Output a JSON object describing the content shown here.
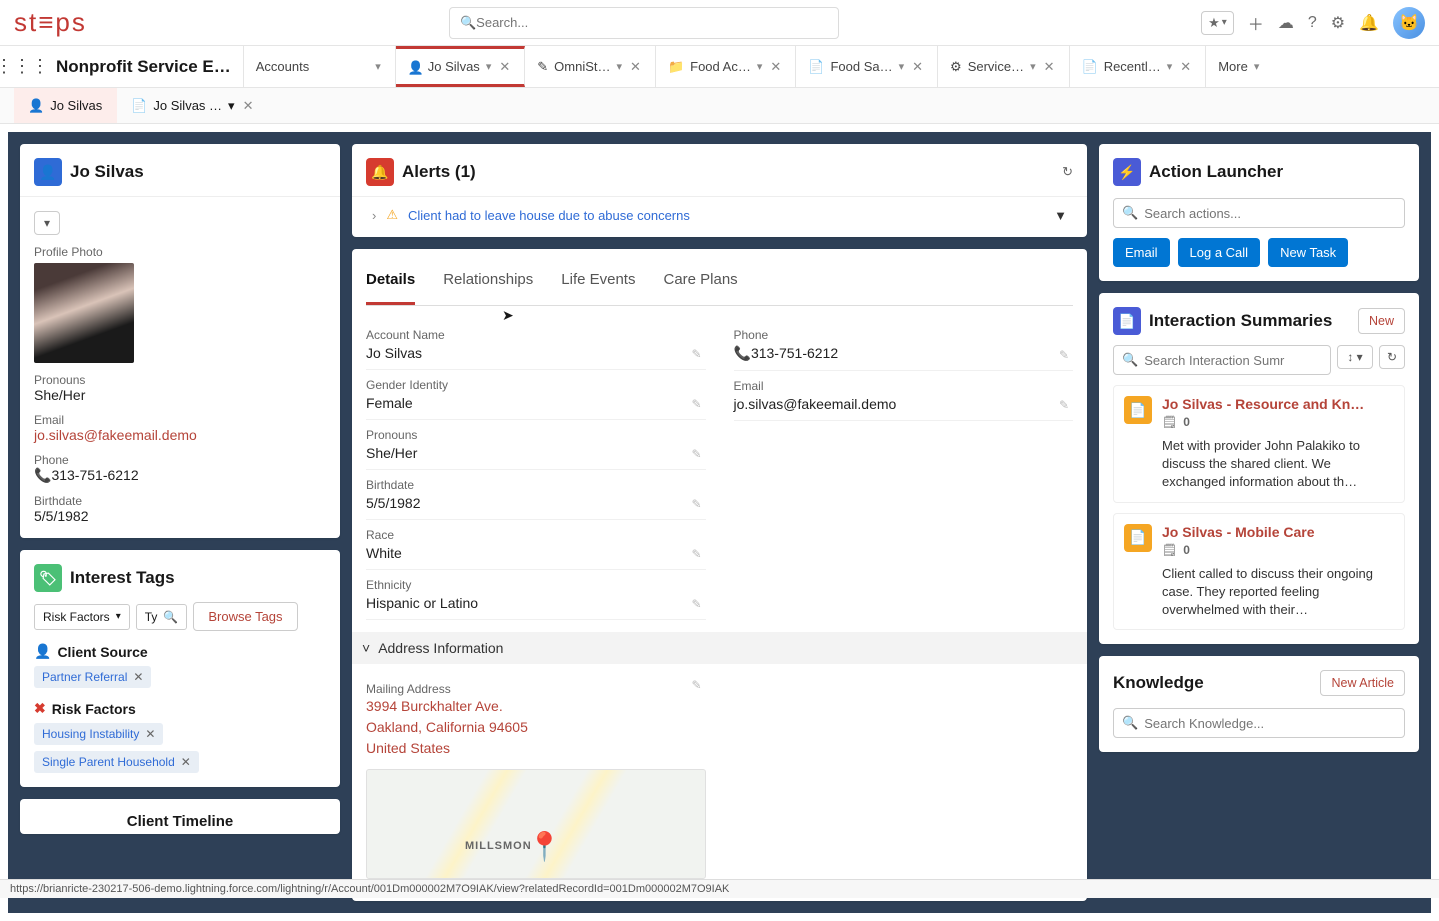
{
  "header": {
    "logo": "st≡ps",
    "search_placeholder": "Search..."
  },
  "nav": {
    "app_name": "Nonprofit Service E…",
    "tabs": [
      {
        "label": "Accounts",
        "has_close": false
      },
      {
        "label": "Jo Silvas",
        "active": true,
        "has_close": true
      },
      {
        "label": "OmniSt…",
        "has_close": true
      },
      {
        "label": "Food Ac…",
        "has_close": true
      },
      {
        "label": "Food Sa…",
        "has_close": true
      },
      {
        "label": "Service…",
        "has_close": true
      },
      {
        "label": "Recentl…",
        "has_close": true
      }
    ],
    "more_label": "More"
  },
  "subtabs": [
    {
      "label": "Jo Silvas",
      "active": true
    },
    {
      "label": "Jo Silvas …",
      "active": false,
      "has_close": true
    }
  ],
  "left": {
    "name": "Jo Silvas",
    "profile_photo_label": "Profile Photo",
    "pronouns_label": "Pronouns",
    "pronouns_value": "She/Her",
    "email_label": "Email",
    "email_value": "jo.silvas@fakeemail.demo",
    "phone_label": "Phone",
    "phone_value": "313-751-6212",
    "birthdate_label": "Birthdate",
    "birthdate_value": "5/5/1982",
    "interest_tags_header": "Interest Tags",
    "tag_filter_label": "Risk Factors",
    "tag_search_placeholder": "Ty",
    "browse_tags_label": "Browse Tags",
    "groups": [
      {
        "name": "Client Source",
        "tags": [
          "Partner Referral"
        ]
      },
      {
        "name": "Risk Factors",
        "risk": true,
        "tags": [
          "Housing Instability",
          "Single Parent Household"
        ]
      }
    ],
    "timeline_header": "Client Timeline"
  },
  "alerts": {
    "header": "Alerts (1)",
    "items": [
      "Client had to leave house due to abuse concerns"
    ]
  },
  "detail_tabs": [
    "Details",
    "Relationships",
    "Life Events",
    "Care Plans"
  ],
  "details": {
    "left_fields": [
      {
        "label": "Account Name",
        "value": "Jo Silvas"
      },
      {
        "label": "Gender Identity",
        "value": "Female"
      },
      {
        "label": "Pronouns",
        "value": "She/Her"
      },
      {
        "label": "Birthdate",
        "value": "5/5/1982"
      },
      {
        "label": "Race",
        "value": "White"
      },
      {
        "label": "Ethnicity",
        "value": "Hispanic or Latino"
      }
    ],
    "right_fields": [
      {
        "label": "Phone",
        "value": "313-751-6212",
        "phone_icon": true
      },
      {
        "label": "Email",
        "value": "jo.silvas@fakeemail.demo",
        "link": true
      }
    ],
    "address_section_header": "Address Information",
    "mailing_address_label": "Mailing Address",
    "address_line1": "3994 Burckhalter Ave.",
    "address_line2": "Oakland, California 94605",
    "address_line3": "United States",
    "map_area_label": "MILLSMON"
  },
  "right": {
    "action_launcher_header": "Action Launcher",
    "action_search_placeholder": "Search actions...",
    "actions": [
      "Email",
      "Log a Call",
      "New Task"
    ],
    "summaries_header": "Interaction Summaries",
    "summaries_new": "New",
    "summaries_search_placeholder": "Search Interaction Sumr",
    "summaries": [
      {
        "title": "Jo Silvas - Resource and Kn…",
        "count": "0",
        "text": "Met with provider John Palakiko to discuss the shared client. We exchanged information about th…"
      },
      {
        "title": "Jo Silvas - Mobile Care",
        "count": "0",
        "text": "Client called to discuss their ongoing case. They reported feeling overwhelmed with their…"
      }
    ],
    "knowledge_header": "Knowledge",
    "knowledge_new": "New Article",
    "knowledge_search_placeholder": "Search Knowledge..."
  },
  "status_url": "https://brianricte-230217-506-demo.lightning.force.com/lightning/r/Account/001Dm000002M7O9IAK/view?relatedRecordId=001Dm000002M7O9IAK"
}
